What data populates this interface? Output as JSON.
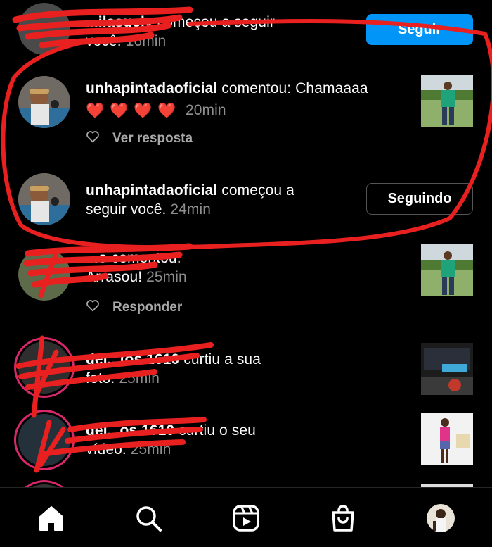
{
  "notifications": [
    {
      "username": "...ilasuelv",
      "action": "começou a seguir",
      "action2": "você.",
      "time": "16min",
      "button": "Seguir"
    },
    {
      "username": "unhapintadaoficial",
      "action": "comentou: Chamaaaa",
      "hearts": [
        "❤️",
        "❤️",
        "❤️",
        "❤️"
      ],
      "time": "20min",
      "meta": "Ver resposta"
    },
    {
      "username": "unhapintadaoficial",
      "action": "começou a",
      "action2": "seguir você.",
      "time": "24min",
      "button": "Seguindo"
    },
    {
      "username": "...o",
      "action": "comentou:",
      "action2": "Arrasou!",
      "time": "25min",
      "meta": "Responder"
    },
    {
      "username": "dei...tos.1610",
      "action": "curtiu a sua",
      "action2": "foto.",
      "time": "25min"
    },
    {
      "username": "dei...os.1610",
      "action": "curtiu o seu",
      "action2": "vídeo.",
      "time": "25min"
    }
  ],
  "tabs": [
    "home-icon",
    "search-icon",
    "reels-icon",
    "shop-icon",
    "profile-avatar"
  ],
  "colors": {
    "accent": "#0095f6",
    "scribble": "#e8201f",
    "background": "#000000"
  }
}
